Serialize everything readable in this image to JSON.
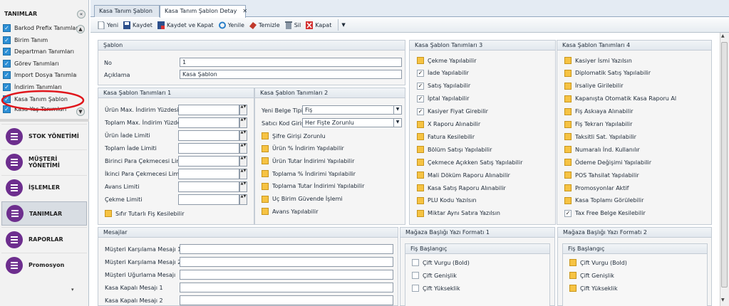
{
  "sidebar": {
    "header": "TANIMLAR",
    "items": [
      {
        "label": "Barkod Prefix Tanımları"
      },
      {
        "label": "Birim Tanım"
      },
      {
        "label": "Departman Tanımları"
      },
      {
        "label": "Görev Tanımları"
      },
      {
        "label": "Import Dosya Tanımları"
      },
      {
        "label": "İndirim Tanımları"
      },
      {
        "label": "Kasa Tanım Şablon"
      },
      {
        "label": "Kasa Yaş Tanımları"
      }
    ],
    "nav": [
      {
        "label": "STOK YÖNETİMİ",
        "icon": "list-icon"
      },
      {
        "label": "MÜŞTERİ YÖNETİMİ",
        "icon": "list-icon"
      },
      {
        "label": "İŞLEMLER",
        "icon": "list-icon"
      },
      {
        "label": "TANIMLAR",
        "icon": "list-icon"
      },
      {
        "label": "RAPORLAR",
        "icon": "list-icon"
      },
      {
        "label": "Promosyon",
        "icon": "list-icon"
      }
    ],
    "active_nav": "TANIMLAR",
    "accent": "#6d2e8e"
  },
  "tabs": [
    {
      "label": "Kasa Tanım Şablon"
    },
    {
      "label": "Kasa Tanım Şablon Detay"
    }
  ],
  "toolbar": {
    "new": "Yeni",
    "save": "Kaydet",
    "save_close": "Kaydet ve Kapat",
    "refresh": "Yenile",
    "clear": "Temizle",
    "delete": "Sil",
    "close": "Kapat"
  },
  "sablon": {
    "title": "Şablon",
    "no_label": "No",
    "no_value": "1",
    "desc_label": "Açıklama",
    "desc_value": "Kasa Şablon"
  },
  "def1": {
    "title": "Kasa Şablon Tanımları 1",
    "fields": [
      "Ürün Max. İndirim Yüzdesi",
      "Toplam Max. İndirim Yüzdesi",
      "Ürün İade Limiti",
      "Toplam İade Limiti",
      "Birinci Para Çekmecesi Limiti",
      "İkinci Para Çekmecesi Limiti",
      "Avans Limiti",
      "Çekme Limiti"
    ],
    "check": "Sıfır Tutarlı Fiş Kesilebilir"
  },
  "def2": {
    "title": "Kasa Şablon Tanımları 2",
    "doc_type_label": "Yeni Belge Tipi",
    "doc_type_value": "Fiş",
    "seller_label": "Satıcı Kod Girişi",
    "seller_value": "Her Fişte Zorunlu",
    "checks": [
      "Şifre Girişi Zorunlu",
      "Ürün % İndirim Yapılabilir",
      "Ürün Tutar İndirimi Yapılabilir",
      "Toplama % İndirimi Yapılabilir",
      "Toplama Tutar İndirimi Yapılabilir",
      "Uç Birim Güvende İşlemi",
      "Avans Yapılabilir"
    ]
  },
  "def3": {
    "title": "Kasa Şablon Tanımları 3",
    "checks": [
      {
        "label": "Çekme Yapılabilir",
        "checked": false
      },
      {
        "label": "İade Yapılabilir",
        "checked": true
      },
      {
        "label": "Satış Yapılabilir",
        "checked": true
      },
      {
        "label": "İptal Yapılabilir",
        "checked": true
      },
      {
        "label": "Kasiyer Fiyat Girebilir",
        "checked": true
      },
      {
        "label": "X Raporu Alınabilir",
        "checked": false
      },
      {
        "label": "Fatura Kesilebilir",
        "checked": false
      },
      {
        "label": "Bölüm Satışı Yapılabilir",
        "checked": false
      },
      {
        "label": "Çekmece Açıkken Satış Yapılabilir",
        "checked": false
      },
      {
        "label": "Mali Döküm Raporu Alınabilir",
        "checked": false
      },
      {
        "label": "Kasa Satış Raporu Alınabilir",
        "checked": false
      },
      {
        "label": "PLU Kodu Yazılsın",
        "checked": false
      },
      {
        "label": "Miktar Aynı Satıra Yazılsın",
        "checked": false
      }
    ]
  },
  "def4": {
    "title": "Kasa Şablon Tanımları 4",
    "checks": [
      {
        "label": "Kasiyer İsmi Yazılsın",
        "checked": false
      },
      {
        "label": "Diplomatik Satış Yapılabilir",
        "checked": false
      },
      {
        "label": "İrsaliye Girilebilir",
        "checked": false
      },
      {
        "label": "Kapanışta Otomatik Kasa Raporu Al",
        "checked": false
      },
      {
        "label": "Fiş Askıaya Alınabilir",
        "checked": false
      },
      {
        "label": "Fiş Tekrarı Yapılabilir",
        "checked": false
      },
      {
        "label": "Taksitli Sat. Yapılabilir",
        "checked": false
      },
      {
        "label": "Numaralı İnd. Kullanılır",
        "checked": false
      },
      {
        "label": "Ödeme Değişimi Yapılabilir",
        "checked": false
      },
      {
        "label": "POS Tahsilat Yapılabilir",
        "checked": false
      },
      {
        "label": "Promosyonlar Aktif",
        "checked": false
      },
      {
        "label": "Kasa Toplamı Görülebilir",
        "checked": false
      },
      {
        "label": "Tax Free Belge Kesilebilir",
        "checked": true
      }
    ]
  },
  "messages": {
    "title": "Mesajlar",
    "fields": [
      "Müşteri Karşılama Mesajı 1",
      "Müşteri Karşılama Mesajı 2",
      "Müşteri Uğurlama Mesajı",
      "Kasa Kapalı Mesajı 1",
      "Kasa Kapalı Mesajı 2"
    ]
  },
  "header1": {
    "title": "Mağaza Başlığı Yazı Formatı 1",
    "group": "Fiş Başlangıç",
    "checks": [
      {
        "label": "Çift Vurgu (Bold)",
        "checked": false
      },
      {
        "label": "Çift Genişlik",
        "checked": false
      },
      {
        "label": "Çift Yükseklik",
        "checked": false
      }
    ]
  },
  "header2": {
    "title": "Mağaza Başlığı Yazı Formatı 2",
    "group": "Fiş Başlangıç",
    "checks": [
      {
        "label": "Çift Vurgu (Bold)",
        "checked": false
      },
      {
        "label": "Çift Genişlik",
        "checked": false
      },
      {
        "label": "Çift Yükseklik",
        "checked": false
      }
    ]
  }
}
